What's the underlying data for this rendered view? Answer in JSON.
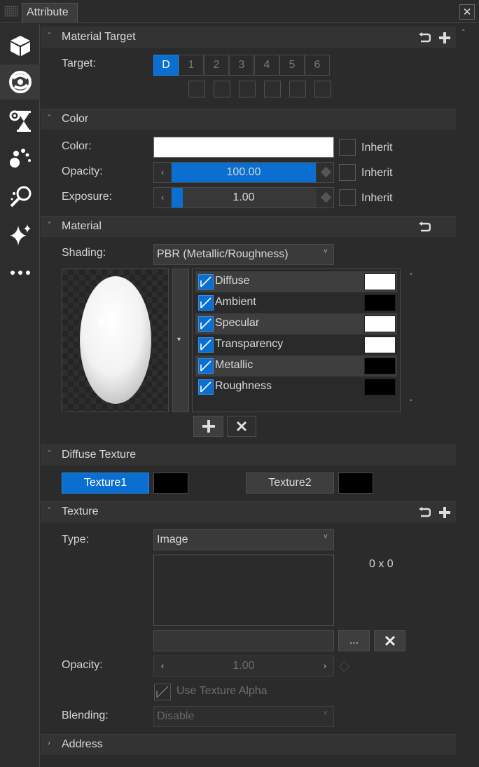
{
  "window": {
    "tab_title": "Attribute",
    "close_glyph": "✕"
  },
  "sidebar": {
    "items": [
      {
        "icon": "cube-icon"
      },
      {
        "icon": "material-sphere-icon",
        "active": true
      },
      {
        "icon": "hourglass-gear-icon"
      },
      {
        "icon": "particles-icon"
      },
      {
        "icon": "brush-icon"
      },
      {
        "icon": "sparkle-icon"
      },
      {
        "icon": "more-icon"
      }
    ]
  },
  "material_target": {
    "title": "Material Target",
    "target_label": "Target:",
    "targets": [
      "D",
      "1",
      "2",
      "3",
      "4",
      "5",
      "6"
    ],
    "selected_target": "D"
  },
  "color": {
    "title": "Color",
    "color_label": "Color:",
    "color_value": "#ffffff",
    "opacity_label": "Opacity:",
    "opacity_value": "100.00",
    "opacity_fraction": 1.0,
    "exposure_label": "Exposure:",
    "exposure_value": "1.00",
    "exposure_fraction": 0.08,
    "inherit_label": "Inherit",
    "slider_left": "‹",
    "slider_right": "›"
  },
  "material": {
    "title": "Material",
    "shading_label": "Shading:",
    "shading_value": "PBR (Metallic/Roughness)",
    "channels": [
      {
        "name": "Diffuse",
        "color": "#ffffff"
      },
      {
        "name": "Ambient",
        "color": "#000000"
      },
      {
        "name": "Specular",
        "color": "#ffffff"
      },
      {
        "name": "Transparency",
        "color": "#ffffff"
      },
      {
        "name": "Metallic",
        "color": "#000000"
      },
      {
        "name": "Roughness",
        "color": "#000000"
      }
    ]
  },
  "diffuse_texture": {
    "title": "Diffuse Texture",
    "texture1_label": "Texture1",
    "texture2_label": "Texture2"
  },
  "texture": {
    "title": "Texture",
    "type_label": "Type:",
    "type_value": "Image",
    "size_text": "0 x 0",
    "browse_label": "...",
    "opacity_label": "Opacity:",
    "opacity_value": "1.00",
    "use_alpha_label": "Use Texture Alpha",
    "blending_label": "Blending:",
    "blending_value": "Disable"
  },
  "address": {
    "title": "Address"
  },
  "colors": {
    "accent": "#0a6fd0",
    "background": "#2b2b2b",
    "header": "#333333"
  }
}
